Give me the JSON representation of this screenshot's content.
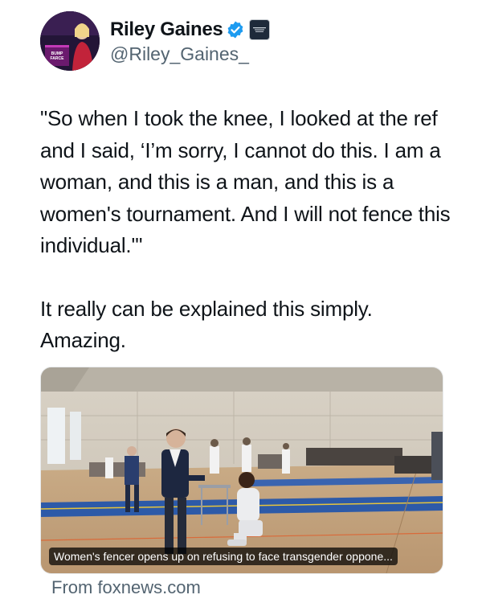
{
  "author": {
    "display_name": "Riley Gaines",
    "handle": "@Riley_Gaines_",
    "avatar_sign": "BUMP FARCE",
    "verified": true,
    "affiliate_badge": "affiliate-org-badge"
  },
  "tweet": {
    "paragraph_1": "\"So when I took the knee, I looked at the ref and I said, ‘I’m sorry, I cannot do this. I am a woman, and this is a man, and this is a women's tournament. And I will not fence this individual.'\"",
    "paragraph_2": "It really can be explained this simply. Amazing."
  },
  "link_card": {
    "caption": "Women's fencer opens up on refusing to face transgender oppone...",
    "source": "From foxnews.com"
  },
  "colors": {
    "verified_blue": "#1d9bf0",
    "secondary_text": "#536471",
    "primary_text": "#0f1419",
    "fencing_strip_blue": "#2d5aa8"
  }
}
